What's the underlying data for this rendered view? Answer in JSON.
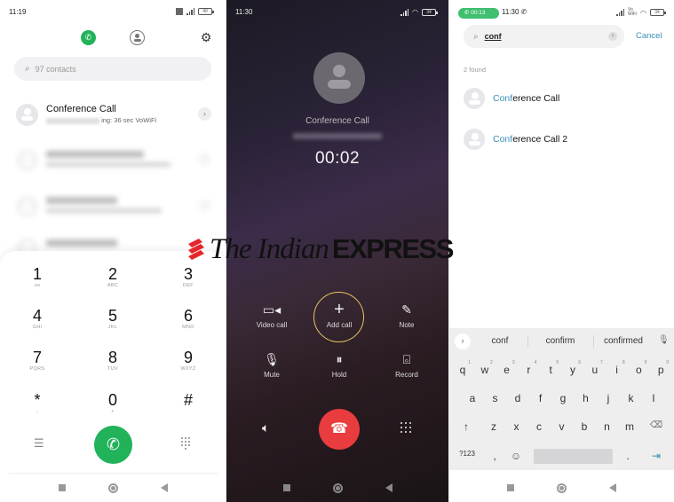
{
  "watermark": {
    "text_serif": "The Indian",
    "text_bold": "EXPRESS",
    "logo_color": "#e3262b"
  },
  "panel1": {
    "status": {
      "time": "11:19",
      "battery": "40"
    },
    "tabs": {
      "phone": "phone-icon",
      "contacts": "contacts-icon",
      "settings": "gear-icon"
    },
    "search_placeholder": "97 contacts",
    "recent": {
      "name": "Conference Call",
      "detail": "ing: 36 sec VoWiFi"
    },
    "dialpad": [
      {
        "digit": "1",
        "letters": "ᴏᴏ"
      },
      {
        "digit": "2",
        "letters": "ABC"
      },
      {
        "digit": "3",
        "letters": "DEF"
      },
      {
        "digit": "4",
        "letters": "GHI"
      },
      {
        "digit": "5",
        "letters": "JKL"
      },
      {
        "digit": "6",
        "letters": "MNO"
      },
      {
        "digit": "7",
        "letters": "PQRS"
      },
      {
        "digit": "8",
        "letters": "TUV"
      },
      {
        "digit": "9",
        "letters": "WXYZ"
      },
      {
        "digit": "*",
        "letters": ","
      },
      {
        "digit": "0",
        "letters": "+"
      },
      {
        "digit": "#",
        "letters": ""
      }
    ],
    "accent": "#21b25a"
  },
  "panel2": {
    "status": {
      "time": "11:30",
      "battery": "34"
    },
    "caller_name": "Conference Call",
    "timer": "00:02",
    "actions": [
      {
        "label": "Video call",
        "icon": "video-camera-icon"
      },
      {
        "label": "Add call",
        "icon": "plus-icon"
      },
      {
        "label": "Note",
        "icon": "note-edit-icon"
      },
      {
        "label": "Mute",
        "icon": "mute-mic-icon"
      },
      {
        "label": "Hold",
        "icon": "pause-icon"
      },
      {
        "label": "Record",
        "icon": "record-tape-icon"
      }
    ],
    "highlight_color": "#e6c35c",
    "end_call_color": "#e93c3e"
  },
  "panel3": {
    "status": {
      "call_duration": "00:13",
      "time": "11:30",
      "battery": "34"
    },
    "search_value": "conf",
    "cancel_label": "Cancel",
    "found_label": "2 found",
    "results": [
      {
        "match": "Conf",
        "rest": "erence Call"
      },
      {
        "match": "Conf",
        "rest": "erence Call 2"
      }
    ],
    "suggestions": [
      "conf",
      "confirm",
      "confirmed"
    ],
    "keyboard": {
      "row1": [
        "q",
        "w",
        "e",
        "r",
        "t",
        "y",
        "u",
        "i",
        "o",
        "p"
      ],
      "row1_hints": [
        "1",
        "2",
        "3",
        "4",
        "5",
        "6",
        "7",
        "8",
        "9",
        "0"
      ],
      "row2": [
        "a",
        "s",
        "d",
        "f",
        "g",
        "h",
        "j",
        "k",
        "l"
      ],
      "row3": [
        "z",
        "x",
        "c",
        "v",
        "b",
        "n",
        "m"
      ],
      "symbols_label": "?123",
      "comma": ",",
      "period": "."
    },
    "accent": "#3a8fb7"
  }
}
